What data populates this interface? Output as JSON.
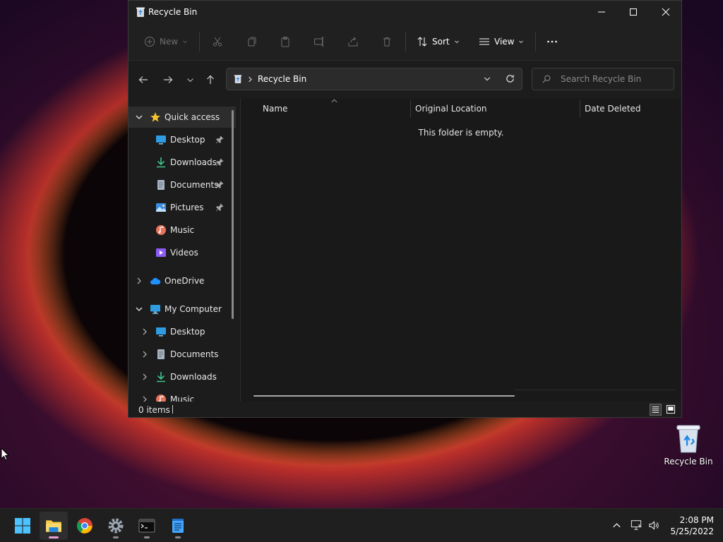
{
  "window": {
    "title": "Recycle Bin"
  },
  "toolbar": {
    "new_label": "New",
    "sort_label": "Sort",
    "view_label": "View"
  },
  "address": {
    "breadcrumb": "Recycle Bin"
  },
  "search": {
    "placeholder": "Search Recycle Bin"
  },
  "navpane": {
    "items": [
      {
        "label": "Quick access",
        "chevron": "expanded"
      },
      {
        "label": "Desktop",
        "pinned": true
      },
      {
        "label": "Downloads",
        "pinned": true
      },
      {
        "label": "Documents",
        "pinned": true
      },
      {
        "label": "Pictures",
        "pinned": true
      },
      {
        "label": "Music"
      },
      {
        "label": "Videos"
      },
      {
        "label": "OneDrive",
        "chevron": "collapsed"
      },
      {
        "label": "My Computer",
        "chevron": "expanded"
      },
      {
        "label": "Desktop",
        "chevron": "collapsed"
      },
      {
        "label": "Documents",
        "chevron": "collapsed"
      },
      {
        "label": "Downloads",
        "chevron": "collapsed"
      },
      {
        "label": "Music",
        "chevron": "collapsed"
      }
    ]
  },
  "columns": {
    "name": "Name",
    "original_location": "Original Location",
    "date_deleted": "Date Deleted"
  },
  "content": {
    "empty_message": "This folder is empty."
  },
  "status": {
    "item_count": "0 items"
  },
  "desktop": {
    "recycle_bin_label": "Recycle Bin"
  },
  "taskbar": {
    "time": "2:08 PM",
    "date": "5/25/2022"
  },
  "colors": {
    "window_bg": "#1c1c1c",
    "taskbar_bg": "#1f1f1f",
    "active_indicator": "#e89dd6",
    "accent_blue": "#1e90ff"
  }
}
